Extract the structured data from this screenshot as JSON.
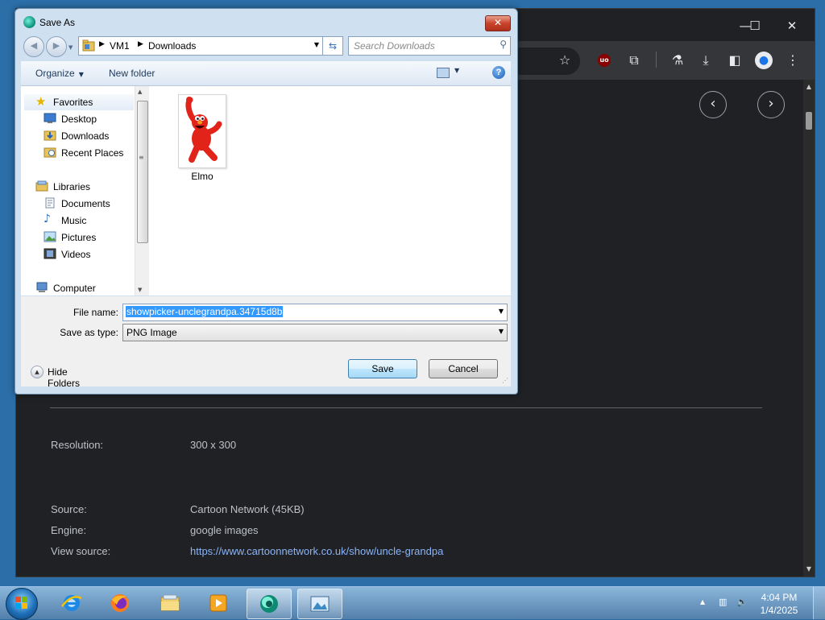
{
  "chrome": {
    "info": {
      "resolution_label": "Resolution:",
      "resolution_value": "300 x 300",
      "source_label": "Source:",
      "source_value": "Cartoon Network (45KB)",
      "engine_label": "Engine:",
      "engine_value": "google images",
      "view_source_label": "View source:",
      "view_source_value": "https://www.cartoonnetwork.co.uk/show/uncle-grandpa"
    },
    "toolbar_icons": [
      "bookmark-star-icon",
      "ublock-icon",
      "extensions-icon",
      "labs-icon",
      "downloads-icon",
      "side-panel-icon",
      "profile-icon",
      "menu-icon"
    ],
    "ublock_text": "uo"
  },
  "dialog": {
    "title": "Save As",
    "breadcrumb": [
      "VM1",
      "Downloads"
    ],
    "search_placeholder": "Search Downloads",
    "toolbar": {
      "organize": "Organize",
      "new_folder": "New folder"
    },
    "nav": {
      "favorites": "Favorites",
      "desktop": "Desktop",
      "downloads": "Downloads",
      "recent_places": "Recent Places",
      "libraries": "Libraries",
      "documents": "Documents",
      "music": "Music",
      "pictures": "Pictures",
      "videos": "Videos",
      "computer": "Computer"
    },
    "files": [
      {
        "name": "Elmo"
      }
    ],
    "file_name_label": "File name:",
    "file_name_value": "showpicker-unclegrandpa.34715d8b",
    "save_type_label": "Save as type:",
    "save_type_value": "PNG Image",
    "hide_folders": "Hide Folders",
    "save_button": "Save",
    "cancel_button": "Cancel"
  },
  "taskbar": {
    "time": "4:04 PM",
    "date": "1/4/2025",
    "pinned": [
      "internet-explorer-icon",
      "firefox-icon",
      "file-explorer-icon",
      "media-player-icon",
      "app-icon",
      "image-viewer-icon"
    ]
  },
  "colors": {
    "chrome_bg": "#202124",
    "link": "#8ab4f8",
    "selection": "#3399ff",
    "dialog_frame": "#cfe0f1"
  }
}
